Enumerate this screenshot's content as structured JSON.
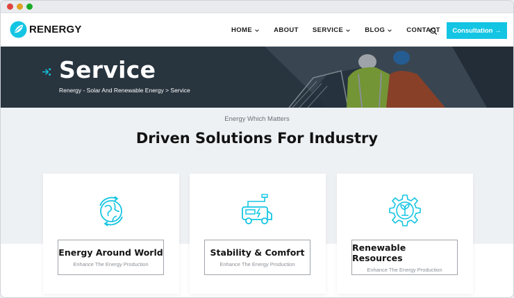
{
  "brand": {
    "name": "RENERGY",
    "accent": "#14c5e3"
  },
  "nav": {
    "items": [
      {
        "label": "HOME",
        "dropdown": true
      },
      {
        "label": "ABOUT",
        "dropdown": false
      },
      {
        "label": "SERVICE",
        "dropdown": true
      },
      {
        "label": "BLOG",
        "dropdown": true
      },
      {
        "label": "CONTACT",
        "dropdown": false
      }
    ],
    "search_icon": "search-icon",
    "cta_label": "Consultation →"
  },
  "hero": {
    "title": "Service",
    "breadcrumb": "Renergy - Solar And Renewable Energy > Service"
  },
  "section": {
    "subtitle": "Energy Which Matters",
    "title": "Driven Solutions For Industry"
  },
  "cards": [
    {
      "icon": "globe-recycle-icon",
      "title": "Energy Around World",
      "desc": "Enhance The Energy Production"
    },
    {
      "icon": "electric-van-icon",
      "title": "Stability & Comfort",
      "desc": "Enhance The Energy Production"
    },
    {
      "icon": "gear-plant-icon",
      "title": "Renewable Resources",
      "desc": "Enhance The Energy Production"
    }
  ]
}
